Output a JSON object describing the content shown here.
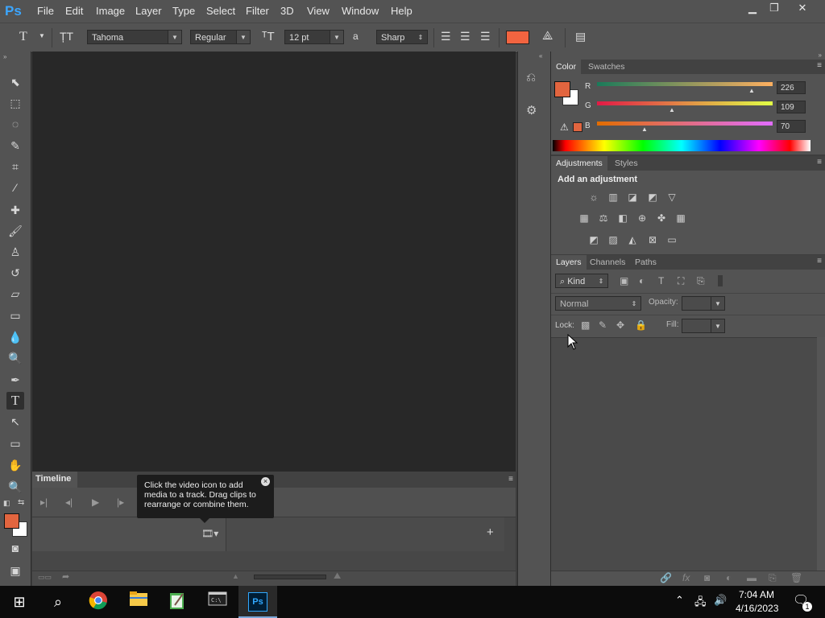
{
  "menubar": {
    "logo": "Ps",
    "items": [
      "File",
      "Edit",
      "Image",
      "Layer",
      "Type",
      "Select",
      "Filter",
      "3D",
      "View",
      "Window",
      "Help"
    ],
    "window_buttons": {
      "minimize": "▁",
      "restore": "❐",
      "close": "✕"
    }
  },
  "options": {
    "font_family": "Tahoma",
    "font_style": "Regular",
    "font_size": "12 pt",
    "antialias_icon": "a",
    "antialias": "Sharp",
    "text_color": "#f26440"
  },
  "timeline": {
    "tab": "Timeline",
    "tooltip": "Click the video icon to add media to a track. Drag clips to rearrange or combine them."
  },
  "color_panel": {
    "tabs": [
      "Color",
      "Swatches"
    ],
    "channels": [
      {
        "label": "R",
        "value": "226"
      },
      {
        "label": "G",
        "value": "109"
      },
      {
        "label": "B",
        "value": "70"
      }
    ],
    "foreground": "#e2653f",
    "background": "#ffffff"
  },
  "adjustments_panel": {
    "tabs": [
      "Adjustments",
      "Styles"
    ],
    "heading": "Add an adjustment"
  },
  "layers_panel": {
    "tabs": [
      "Layers",
      "Channels",
      "Paths"
    ],
    "kind": "Kind",
    "blend_mode": "Normal",
    "opacity_label": "Opacity:",
    "lock_label": "Lock:",
    "fill_label": "Fill:"
  },
  "taskbar": {
    "time": "7:04 AM",
    "date": "4/16/2023",
    "notification_count": "1"
  }
}
